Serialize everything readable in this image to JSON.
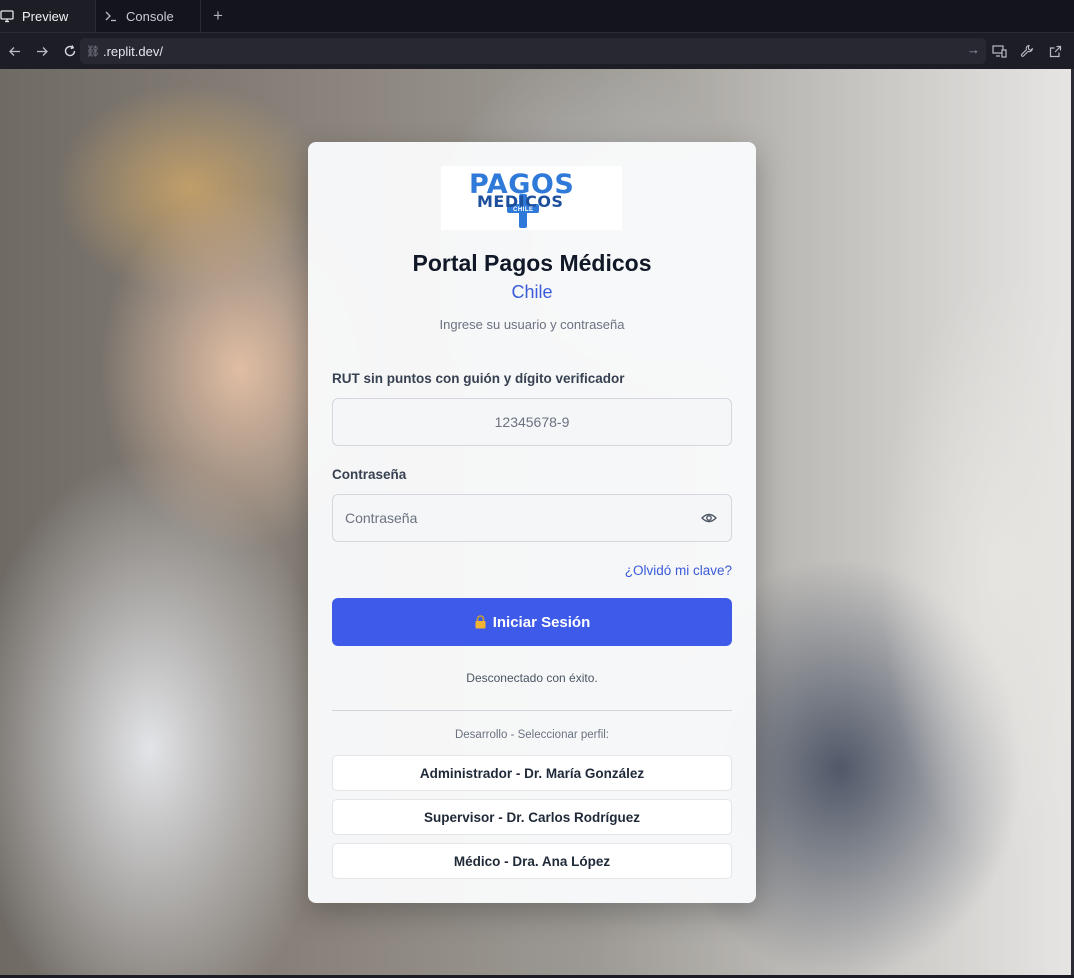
{
  "tabs": [
    {
      "label": "Preview",
      "icon": "monitor-icon",
      "active": true
    },
    {
      "label": "Console",
      "icon": "terminal-icon",
      "active": false
    }
  ],
  "address": {
    "url": ".replit.dev/"
  },
  "card": {
    "logo_text_top": "PAGOS",
    "logo_text_bottom": "MEDICOS",
    "logo_text_sub": "CHILE",
    "title": "Portal Pagos Médicos",
    "subtitle": "Chile",
    "hint": "Ingrese su usuario y contraseña",
    "rut_label": "RUT sin puntos con guión y dígito verificador",
    "rut_placeholder": "12345678-9",
    "password_label": "Contraseña",
    "password_placeholder": "Contraseña",
    "forgot_link": "¿Olvidó mi clave?",
    "login_button": "Iniciar Sesión",
    "status_message": "Desconectado con éxito.",
    "dev_label": "Desarrollo - Seleccionar perfil:",
    "profiles": [
      "Administrador - Dr. María González",
      "Supervisor - Dr. Carlos Rodríguez",
      "Médico - Dra. Ana López"
    ]
  },
  "colors": {
    "accent": "#3d5be8",
    "link": "#3b5bdb",
    "logo_blue": "#2f7ad8"
  }
}
